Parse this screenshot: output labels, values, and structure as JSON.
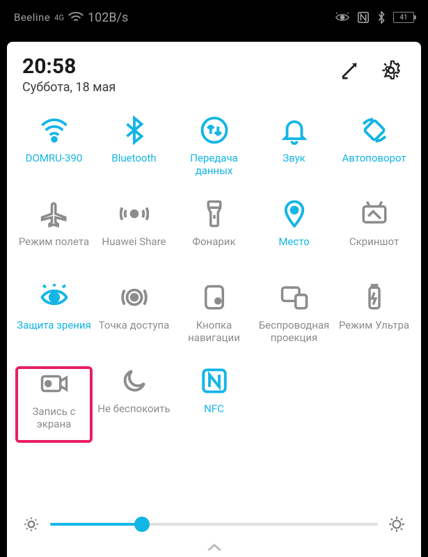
{
  "status": {
    "carrier": "Beeline",
    "signal": "4G",
    "speed": "102B/s",
    "battery_pct": "41"
  },
  "header": {
    "time": "20:58",
    "date": "Суббота, 18 мая"
  },
  "tiles": [
    {
      "id": "wifi",
      "label": "DOMRU-390",
      "active": true,
      "icon": "wifi-icon"
    },
    {
      "id": "bluetooth",
      "label": "Bluetooth",
      "active": true,
      "icon": "bluetooth-icon"
    },
    {
      "id": "data",
      "label": "Передача данных",
      "active": true,
      "icon": "data-swap-icon"
    },
    {
      "id": "sound",
      "label": "Звук",
      "active": true,
      "icon": "bell-icon"
    },
    {
      "id": "autorotate",
      "label": "Автоповорот",
      "active": true,
      "icon": "autorotate-icon"
    },
    {
      "id": "airplane",
      "label": "Режим полета",
      "active": false,
      "icon": "airplane-icon"
    },
    {
      "id": "huaweishare",
      "label": "Huawei Share",
      "active": false,
      "icon": "huaweishare-icon"
    },
    {
      "id": "flashlight",
      "label": "Фонарик",
      "active": false,
      "icon": "flashlight-icon"
    },
    {
      "id": "location",
      "label": "Место",
      "active": true,
      "icon": "location-icon"
    },
    {
      "id": "screenshot",
      "label": "Скриншот",
      "active": false,
      "icon": "screenshot-icon"
    },
    {
      "id": "eyecomfort",
      "label": "Защита зрения",
      "active": true,
      "icon": "eye-icon"
    },
    {
      "id": "hotspot",
      "label": "Точка доступа",
      "active": false,
      "icon": "hotspot-icon"
    },
    {
      "id": "navbutton",
      "label": "Кнопка навигации",
      "active": false,
      "icon": "navbutton-icon"
    },
    {
      "id": "wireless",
      "label": "Беспроводная проекция",
      "active": false,
      "icon": "castscreen-icon"
    },
    {
      "id": "ultra",
      "label": "Режим Ультра",
      "active": false,
      "icon": "battery-ultra-icon"
    },
    {
      "id": "screenrec",
      "label": "Запись с экрана",
      "active": false,
      "icon": "screenrec-icon",
      "highlighted": true
    },
    {
      "id": "dnd",
      "label": "Не беспокоить",
      "active": false,
      "icon": "moon-icon"
    },
    {
      "id": "nfc",
      "label": "NFC",
      "active": true,
      "icon": "nfc-icon"
    }
  ],
  "brightness": {
    "percent": 28
  }
}
